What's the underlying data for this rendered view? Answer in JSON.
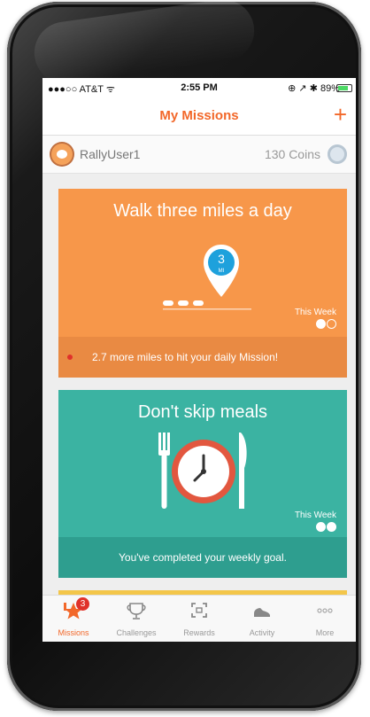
{
  "status_bar": {
    "carrier": "●●●○○ AT&T ᯤ",
    "time": "2:55 PM",
    "right": "⊕ ↗ ✱ 89%"
  },
  "nav": {
    "title": "My Missions",
    "add_label": "+"
  },
  "user": {
    "name": "RallyUser1",
    "coins": "130 Coins"
  },
  "missions": [
    {
      "title": "Walk three miles a day",
      "pin_number": "3",
      "pin_unit": "MI",
      "week_label": "This Week",
      "footer": "2.7 more miles to hit your daily Mission!",
      "color": "#f7974a"
    },
    {
      "title": "Don't skip meals",
      "week_label": "This Week",
      "footer": "You've completed your weekly goal.",
      "color": "#3bb3a2"
    }
  ],
  "tabs": [
    {
      "label": "Missions",
      "icon": "missions-icon",
      "badge": "3",
      "active": true
    },
    {
      "label": "Challenges",
      "icon": "trophy-icon"
    },
    {
      "label": "Rewards",
      "icon": "rewards-icon"
    },
    {
      "label": "Activity",
      "icon": "shoe-icon"
    },
    {
      "label": "More",
      "icon": "more-icon"
    }
  ],
  "colors": {
    "accent": "#f2682a",
    "orange_card": "#f7974a",
    "teal_card": "#3bb3a2",
    "pin_blue": "#1ea1dc"
  }
}
